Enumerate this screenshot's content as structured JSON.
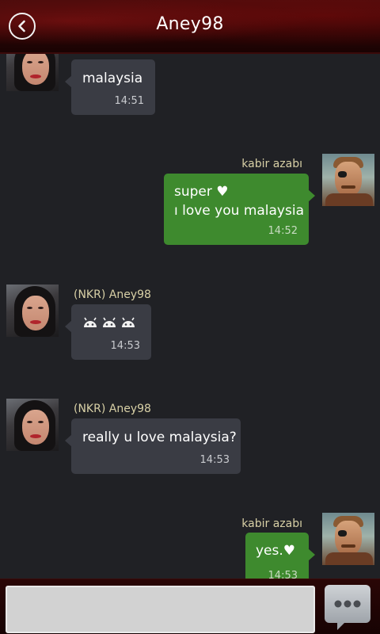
{
  "header": {
    "title": "Aney98",
    "back_icon": "back-arrow-circle-icon"
  },
  "messages": [
    {
      "side": "in",
      "sender": "",
      "lines": [
        "malaysia"
      ],
      "time": "14:51"
    },
    {
      "side": "out",
      "sender": "kabir azabı",
      "lines": [
        "super ♥",
        "ı love you malaysia"
      ],
      "time": "14:52"
    },
    {
      "side": "in",
      "sender": "(NKR) Aney98",
      "emoji": [
        "android-icon",
        "android-icon",
        "android-icon"
      ],
      "time": "14:53"
    },
    {
      "side": "in",
      "sender": "(NKR) Aney98",
      "lines": [
        "really u love malaysia?"
      ],
      "time": "14:53"
    },
    {
      "side": "out",
      "sender": "kabir azabı",
      "lines": [
        "yes.♥"
      ],
      "time": "14:53"
    }
  ],
  "composer": {
    "input_value": "",
    "input_placeholder": "",
    "send_icon": "chat-bubble-dots-icon"
  },
  "colors": {
    "incoming_bubble": "#3a3c44",
    "outgoing_bubble": "#3e8a2e",
    "sender_name": "#d8d0a6",
    "background": "#202125",
    "header": "#2a0505"
  }
}
